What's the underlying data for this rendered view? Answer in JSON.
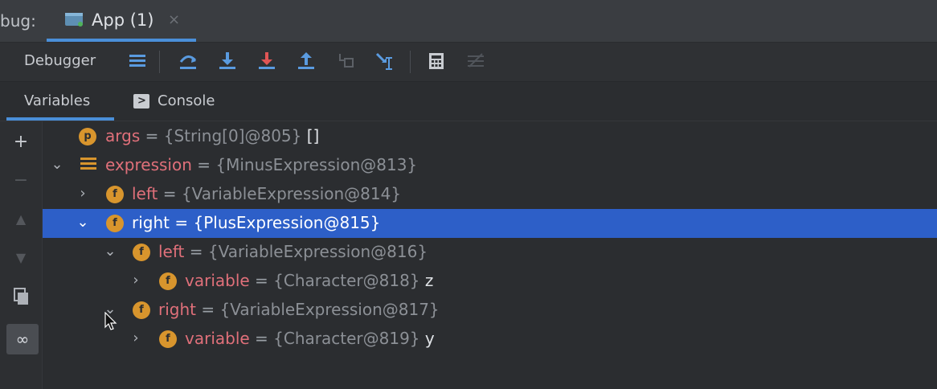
{
  "tabbar": {
    "prefix": "bug:",
    "tab": {
      "label": "App (1)",
      "close": "×"
    }
  },
  "toolbar": {
    "title": "Debugger",
    "buttons": [
      "show-execution-point-icon",
      "step-over-icon",
      "step-into-icon",
      "force-step-into-icon",
      "step-out-icon",
      "drop-frame-icon",
      "run-to-cursor-icon",
      "evaluate-expression-icon",
      "trace-icon"
    ]
  },
  "subtabs": {
    "variables": "Variables",
    "console": "Console"
  },
  "gutter": {
    "add": "+",
    "remove": "−",
    "up": "▲",
    "down": "▼",
    "watch": "∞"
  },
  "variables": [
    {
      "arrow": "",
      "badge": "p",
      "name": "args",
      "eq": " = ",
      "type": "{String[0]@805}",
      "value": " []"
    },
    {
      "arrow": "⌄",
      "badge": "",
      "name": "expression",
      "eq": " = ",
      "type": "{MinusExpression@813}",
      "value": ""
    },
    {
      "arrow": "›",
      "badge": "f",
      "name": "left",
      "eq": " = ",
      "type": "{VariableExpression@814}",
      "value": ""
    },
    {
      "arrow": "⌄",
      "badge": "f",
      "name": "right",
      "eq": " = ",
      "type": "{PlusExpression@815}",
      "value": ""
    },
    {
      "arrow": "⌄",
      "badge": "f",
      "name": "left",
      "eq": " = ",
      "type": "{VariableExpression@816}",
      "value": ""
    },
    {
      "arrow": "›",
      "badge": "f",
      "name": "variable",
      "eq": " = ",
      "type": "{Character@818}",
      "value": " z"
    },
    {
      "arrow": "⌄",
      "badge": "f",
      "name": "right",
      "eq": " = ",
      "type": "{VariableExpression@817}",
      "value": ""
    },
    {
      "arrow": "›",
      "badge": "f",
      "name": "variable",
      "eq": " = ",
      "type": "{Character@819}",
      "value": " y"
    }
  ]
}
